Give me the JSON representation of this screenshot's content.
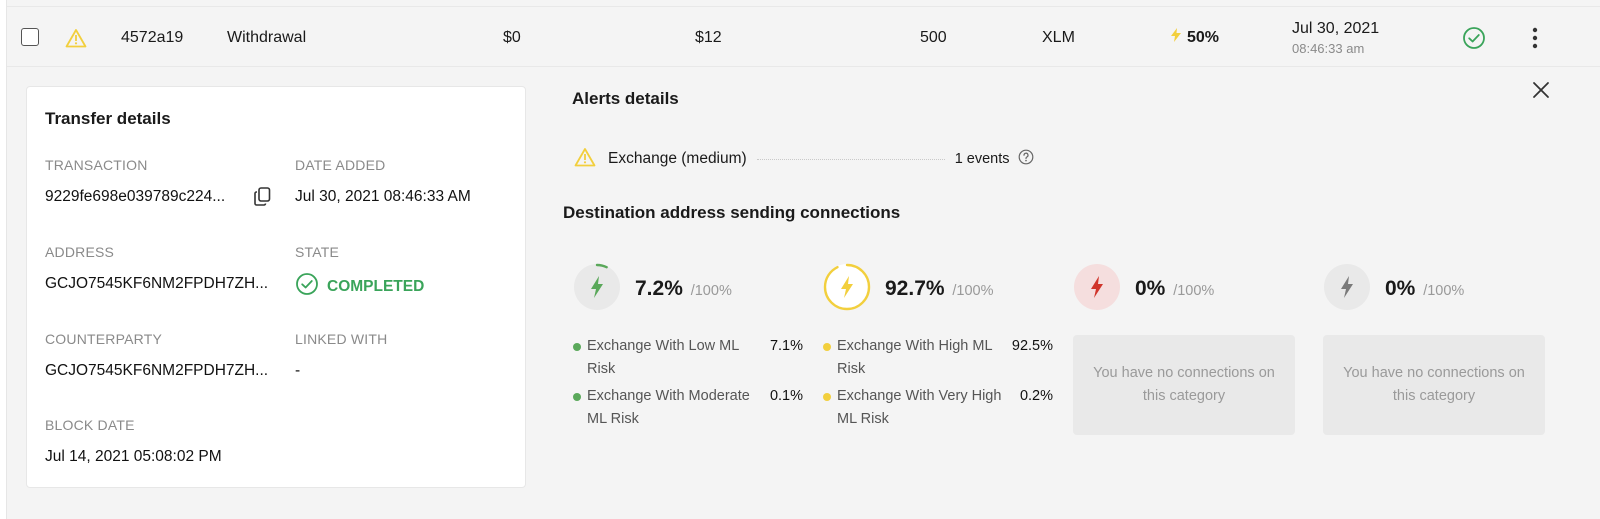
{
  "row": {
    "id": "4572a19",
    "type": "Withdrawal",
    "value1": "$0",
    "value2": "$12",
    "quantity": "500",
    "asset": "XLM",
    "risk": "50%",
    "date": "Jul 30, 2021",
    "time": "08:46:33 am"
  },
  "transfer": {
    "title": "Transfer details",
    "transaction_label": "TRANSACTION",
    "transaction_value": "9229fe698e039789c224...",
    "date_added_label": "DATE ADDED",
    "date_added_value": "Jul 30, 2021 08:46:33 AM",
    "address_label": "ADDRESS",
    "address_value": "GCJO7545KF6NM2FPDH7ZH...",
    "state_label": "STATE",
    "state_value": "COMPLETED",
    "counterparty_label": "COUNTERPARTY",
    "counterparty_value": "GCJO7545KF6NM2FPDH7ZH...",
    "linked_label": "LINKED WITH",
    "linked_value": "-",
    "block_date_label": "BLOCK DATE",
    "block_date_value": "Jul 14, 2021 05:08:02 PM"
  },
  "alerts": {
    "title": "Alerts details",
    "item_label": "Exchange (medium)",
    "item_count": "1 events"
  },
  "destination": {
    "title": "Destination address sending connections",
    "of_label": "/100%",
    "groups": [
      {
        "percent": "7.2%",
        "fill": 0.072,
        "color": "#5aa85a",
        "items": [
          {
            "name": "Exchange With Low ML Risk",
            "value": "7.1%"
          },
          {
            "name": "Exchange With Moderate ML Risk",
            "value": "0.1%"
          }
        ]
      },
      {
        "percent": "92.7%",
        "fill": 0.927,
        "color": "#f2cf3d",
        "items": [
          {
            "name": "Exchange With High ML Risk",
            "value": "92.5%"
          },
          {
            "name": "Exchange With Very High ML Risk",
            "value": "0.2%"
          }
        ]
      },
      {
        "percent": "0%",
        "fill": 0,
        "color": "#d0352b",
        "empty_text": "You have no connections on this category"
      },
      {
        "percent": "0%",
        "fill": 0,
        "color": "#7a7a7a",
        "empty_text": "You have no connections on this category"
      }
    ]
  },
  "icons": {
    "warning": "warning-icon",
    "copy": "copy-icon",
    "check": "check-circle-icon",
    "menu": "more-vertical-icon",
    "close": "close-icon",
    "help": "help-circle-icon",
    "bolt": "lightning-icon"
  }
}
